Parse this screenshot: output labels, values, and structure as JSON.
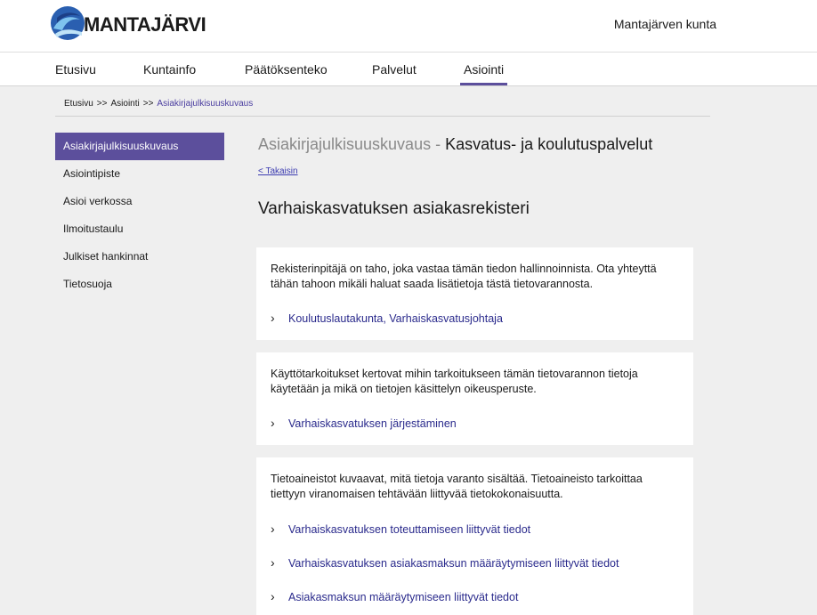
{
  "header": {
    "logo_text": "MANTAJÄRVI",
    "municipality": "Mantajärven kunta"
  },
  "topnav": [
    {
      "label": "Etusivu"
    },
    {
      "label": "Kuntainfo"
    },
    {
      "label": "Päätöksenteko"
    },
    {
      "label": "Palvelut"
    },
    {
      "label": "Asiointi"
    }
  ],
  "breadcrumb": {
    "items": [
      "Etusivu",
      "Asiointi",
      "Asiakirjajulkisuuskuvaus"
    ],
    "separator": ">>"
  },
  "sidenav": [
    {
      "label": "Asiakirjajulkisuuskuvaus"
    },
    {
      "label": "Asiointipiste"
    },
    {
      "label": "Asioi verkossa"
    },
    {
      "label": "Ilmoitustaulu"
    },
    {
      "label": "Julkiset hankinnat"
    },
    {
      "label": "Tietosuoja"
    }
  ],
  "page": {
    "title_prefix": "Asiakirjajulkisuuskuvaus -",
    "title_main": "Kasvatus- ja koulutuspalvelut",
    "back_link": "< Takaisin",
    "register_title": "Varhaiskasvatuksen asiakasrekisteri"
  },
  "cards": [
    {
      "text": "Rekisterinpitäjä on taho, joka vastaa tämän tiedon hallinnoinnista. Ota yhteyttä tähän tahoon mikäli haluat saada lisätietoja tästä tietovarannosta.",
      "links": [
        "Koulutuslautakunta, Varhaiskasvatusjohtaja"
      ]
    },
    {
      "text": "Käyttötarkoitukset kertovat mihin tarkoitukseen tämän tietovarannon tietoja käytetään ja mikä on tietojen käsittelyn oikeusperuste.",
      "links": [
        "Varhaiskasvatuksen järjestäminen"
      ]
    },
    {
      "text": "Tietoaineistot kuvaavat, mitä tietoja varanto sisältää. Tietoaineisto tarkoittaa tiettyyn viranomaisen tehtävään liittyvää tietokokonaisuutta.",
      "links": [
        "Varhaiskasvatuksen toteuttamiseen liittyvät tiedot",
        "Varhaiskasvatuksen asiakasmaksun määräytymiseen liittyvät tiedot",
        "Asiakasmaksun määräytymiseen liittyvät tiedot"
      ]
    }
  ],
  "colors": {
    "accent": "#5c4f9c",
    "link": "#2a2a8c",
    "background": "#efefef"
  },
  "icons": {
    "chevron": "chevron-right-icon",
    "logo": "wave-logo-icon"
  }
}
